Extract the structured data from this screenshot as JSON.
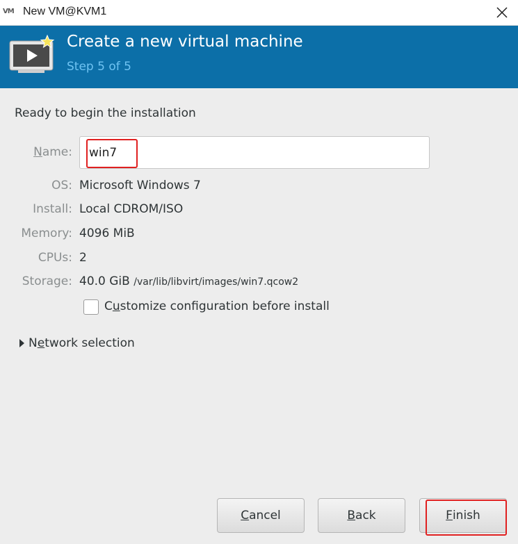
{
  "window": {
    "logo_text": "VM",
    "title": "New VM@KVM1"
  },
  "header": {
    "title": "Create a new virtual machine",
    "step": "Step 5 of 5"
  },
  "content": {
    "ready_text": "Ready to begin the installation",
    "name_label_mnemonic": "N",
    "name_label_rest": "ame:",
    "name_value": "win7",
    "rows": {
      "os": {
        "label": "OS:",
        "value": "Microsoft Windows 7"
      },
      "install": {
        "label": "Install:",
        "value": "Local CDROM/ISO"
      },
      "memory": {
        "label": "Memory:",
        "value": "4096 MiB"
      },
      "cpus": {
        "label": "CPUs:",
        "value": "2"
      },
      "storage": {
        "label": "Storage:",
        "value": "40.0 GiB",
        "path": "/var/lib/libvirt/images/win7.qcow2"
      }
    },
    "customize": {
      "pre": "C",
      "mnemonic": "u",
      "post": "stomize configuration before install",
      "checked": false
    },
    "network": {
      "pre": "N",
      "mnemonic": "e",
      "post": "twork selection"
    }
  },
  "buttons": {
    "cancel": {
      "mnemonic": "C",
      "rest": "ancel"
    },
    "back": {
      "mnemonic": "B",
      "rest": "ack"
    },
    "finish": {
      "mnemonic": "F",
      "rest": "inish"
    }
  },
  "colors": {
    "header_bg": "#0c6fa8",
    "step_text": "#6fc3f2",
    "highlight": "#e02020"
  }
}
